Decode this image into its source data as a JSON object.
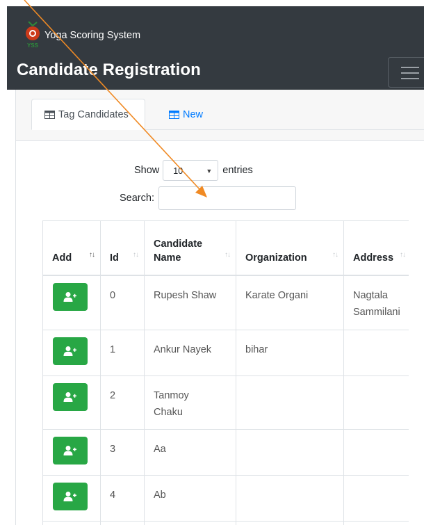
{
  "app": {
    "brand_name": "Yoga Scoring System",
    "logo_text": "YSS",
    "page_title": "Candidate Registration"
  },
  "tabs": [
    {
      "label": "Tag Candidates",
      "icon": "table-icon",
      "active": true
    },
    {
      "label": "New",
      "icon": "table-icon",
      "active": false
    }
  ],
  "controls": {
    "show_label": "Show",
    "entries_value": "10",
    "entries_label": "entries",
    "search_label": "Search:",
    "search_value": ""
  },
  "table": {
    "columns": [
      "Add",
      "Id",
      "Candidate Name",
      "Organization",
      "Address"
    ],
    "rows": [
      {
        "id": "0",
        "name": "Rupesh Shaw",
        "organization": "Karate Organi",
        "address": "Nagtala Sammilani"
      },
      {
        "id": "1",
        "name": "Ankur Nayek",
        "organization": "bihar",
        "address": ""
      },
      {
        "id": "2",
        "name": "Tanmoy Chaku",
        "organization": "",
        "address": ""
      },
      {
        "id": "3",
        "name": "Aa",
        "organization": "",
        "address": ""
      },
      {
        "id": "4",
        "name": "Ab",
        "organization": "",
        "address": ""
      }
    ]
  },
  "colors": {
    "navbar": "#343a40",
    "primary": "#007bff",
    "success": "#28a745",
    "annotation_arrow": "#f08a24"
  }
}
